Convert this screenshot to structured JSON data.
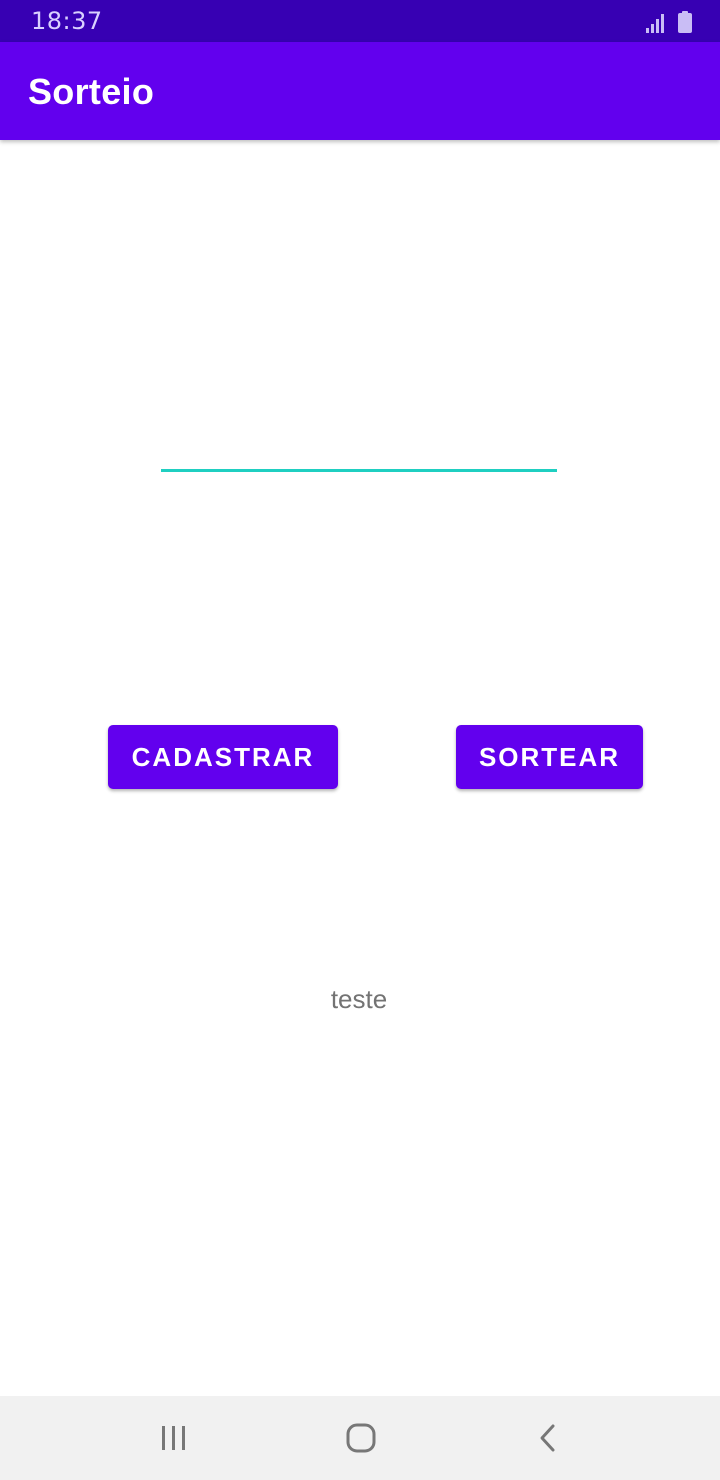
{
  "status_bar": {
    "time": "18:37",
    "icons": [
      "signal-icon",
      "battery-icon"
    ]
  },
  "app_bar": {
    "title": "Sorteio",
    "color": "#6200ee"
  },
  "form": {
    "input_value": "",
    "underline_color": "#1fcfc1"
  },
  "buttons": {
    "cadastrar_label": "CADASTRAR",
    "sortear_label": "SORTEAR",
    "color": "#6200ee"
  },
  "result": {
    "text": "teste"
  },
  "nav_bar": {
    "icons": [
      "recents-icon",
      "home-icon",
      "back-icon"
    ]
  }
}
